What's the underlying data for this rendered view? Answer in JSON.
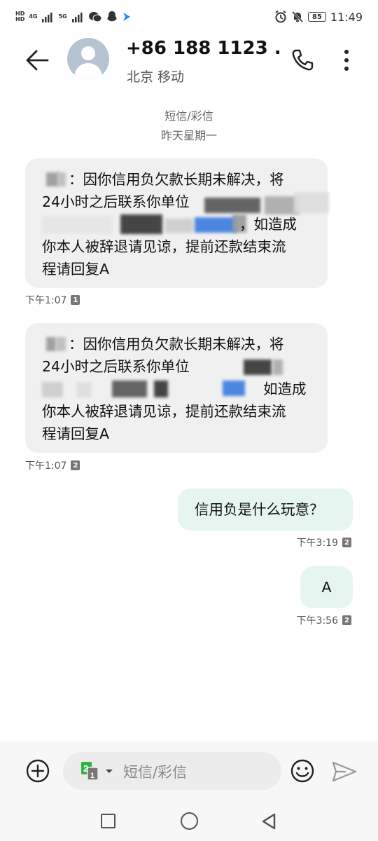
{
  "status_bar": {
    "left_labels": [
      "HD",
      "4G",
      "5G",
      "HD"
    ],
    "battery": "85",
    "time": "11:49"
  },
  "header": {
    "contact_name": "+86 188 1123 ...",
    "contact_subtitle": "北京 移动"
  },
  "thread": {
    "type_label": "短信/彩信",
    "date_label": "昨天星期一"
  },
  "messages": [
    {
      "direction": "incoming",
      "lines": [
        "：因你信用负欠款长期未解决，将",
        "24小时之后联系你单位",
        "，如造成",
        "你本人被辞退请见谅，提前还款结束流",
        "程请回复A"
      ],
      "time": "下午1:07",
      "sim": "1"
    },
    {
      "direction": "incoming",
      "lines": [
        "：因你信用负欠款长期未解决，将",
        "24小时之后联系你单位",
        "如造成",
        "你本人被辞退请见谅，提前还款结束流",
        "程请回复A"
      ],
      "time": "下午1:07",
      "sim": "2"
    },
    {
      "direction": "outgoing",
      "text": "信用负是什么玩意？",
      "time": "下午3:19",
      "sim": "2"
    },
    {
      "direction": "outgoing",
      "text": "A",
      "time": "下午3:56",
      "sim": "2"
    }
  ],
  "input": {
    "placeholder": "短信/彩信",
    "sim_selected": "2",
    "sim_secondary": "1"
  },
  "colors": {
    "incoming_bubble": "#f0f0f0",
    "outgoing_bubble": "#e6f5ef",
    "sim_green": "#2fb344"
  },
  "icons": [
    "back-arrow-icon",
    "phone-icon",
    "more-vert-icon",
    "add-circle-icon",
    "emoji-icon",
    "send-icon",
    "nav-recents-icon",
    "nav-home-icon",
    "nav-back-icon"
  ]
}
